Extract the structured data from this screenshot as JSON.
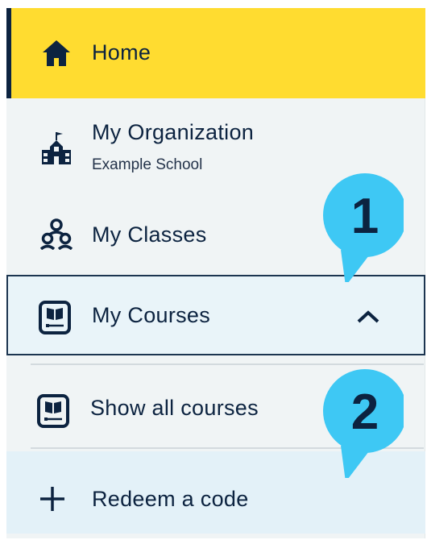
{
  "nav": {
    "home": {
      "label": "Home",
      "icon": "home-icon"
    },
    "organization": {
      "label": "My Organization",
      "sublabel": "Example School",
      "icon": "school-building-icon"
    },
    "classes": {
      "label": "My Classes",
      "icon": "people-group-icon"
    },
    "courses": {
      "label": "My Courses",
      "icon": "book-icon",
      "expanded": true
    },
    "show_all": {
      "label": "Show all courses",
      "icon": "book-icon"
    },
    "redeem": {
      "label": "Redeem a code",
      "icon": "plus-icon"
    }
  },
  "callouts": [
    {
      "number": "1"
    },
    {
      "number": "2"
    }
  ],
  "colors": {
    "accent": "#ffdc30",
    "navy": "#0c2340",
    "callout": "#3ec8f4",
    "background": "#f0f4f5"
  }
}
